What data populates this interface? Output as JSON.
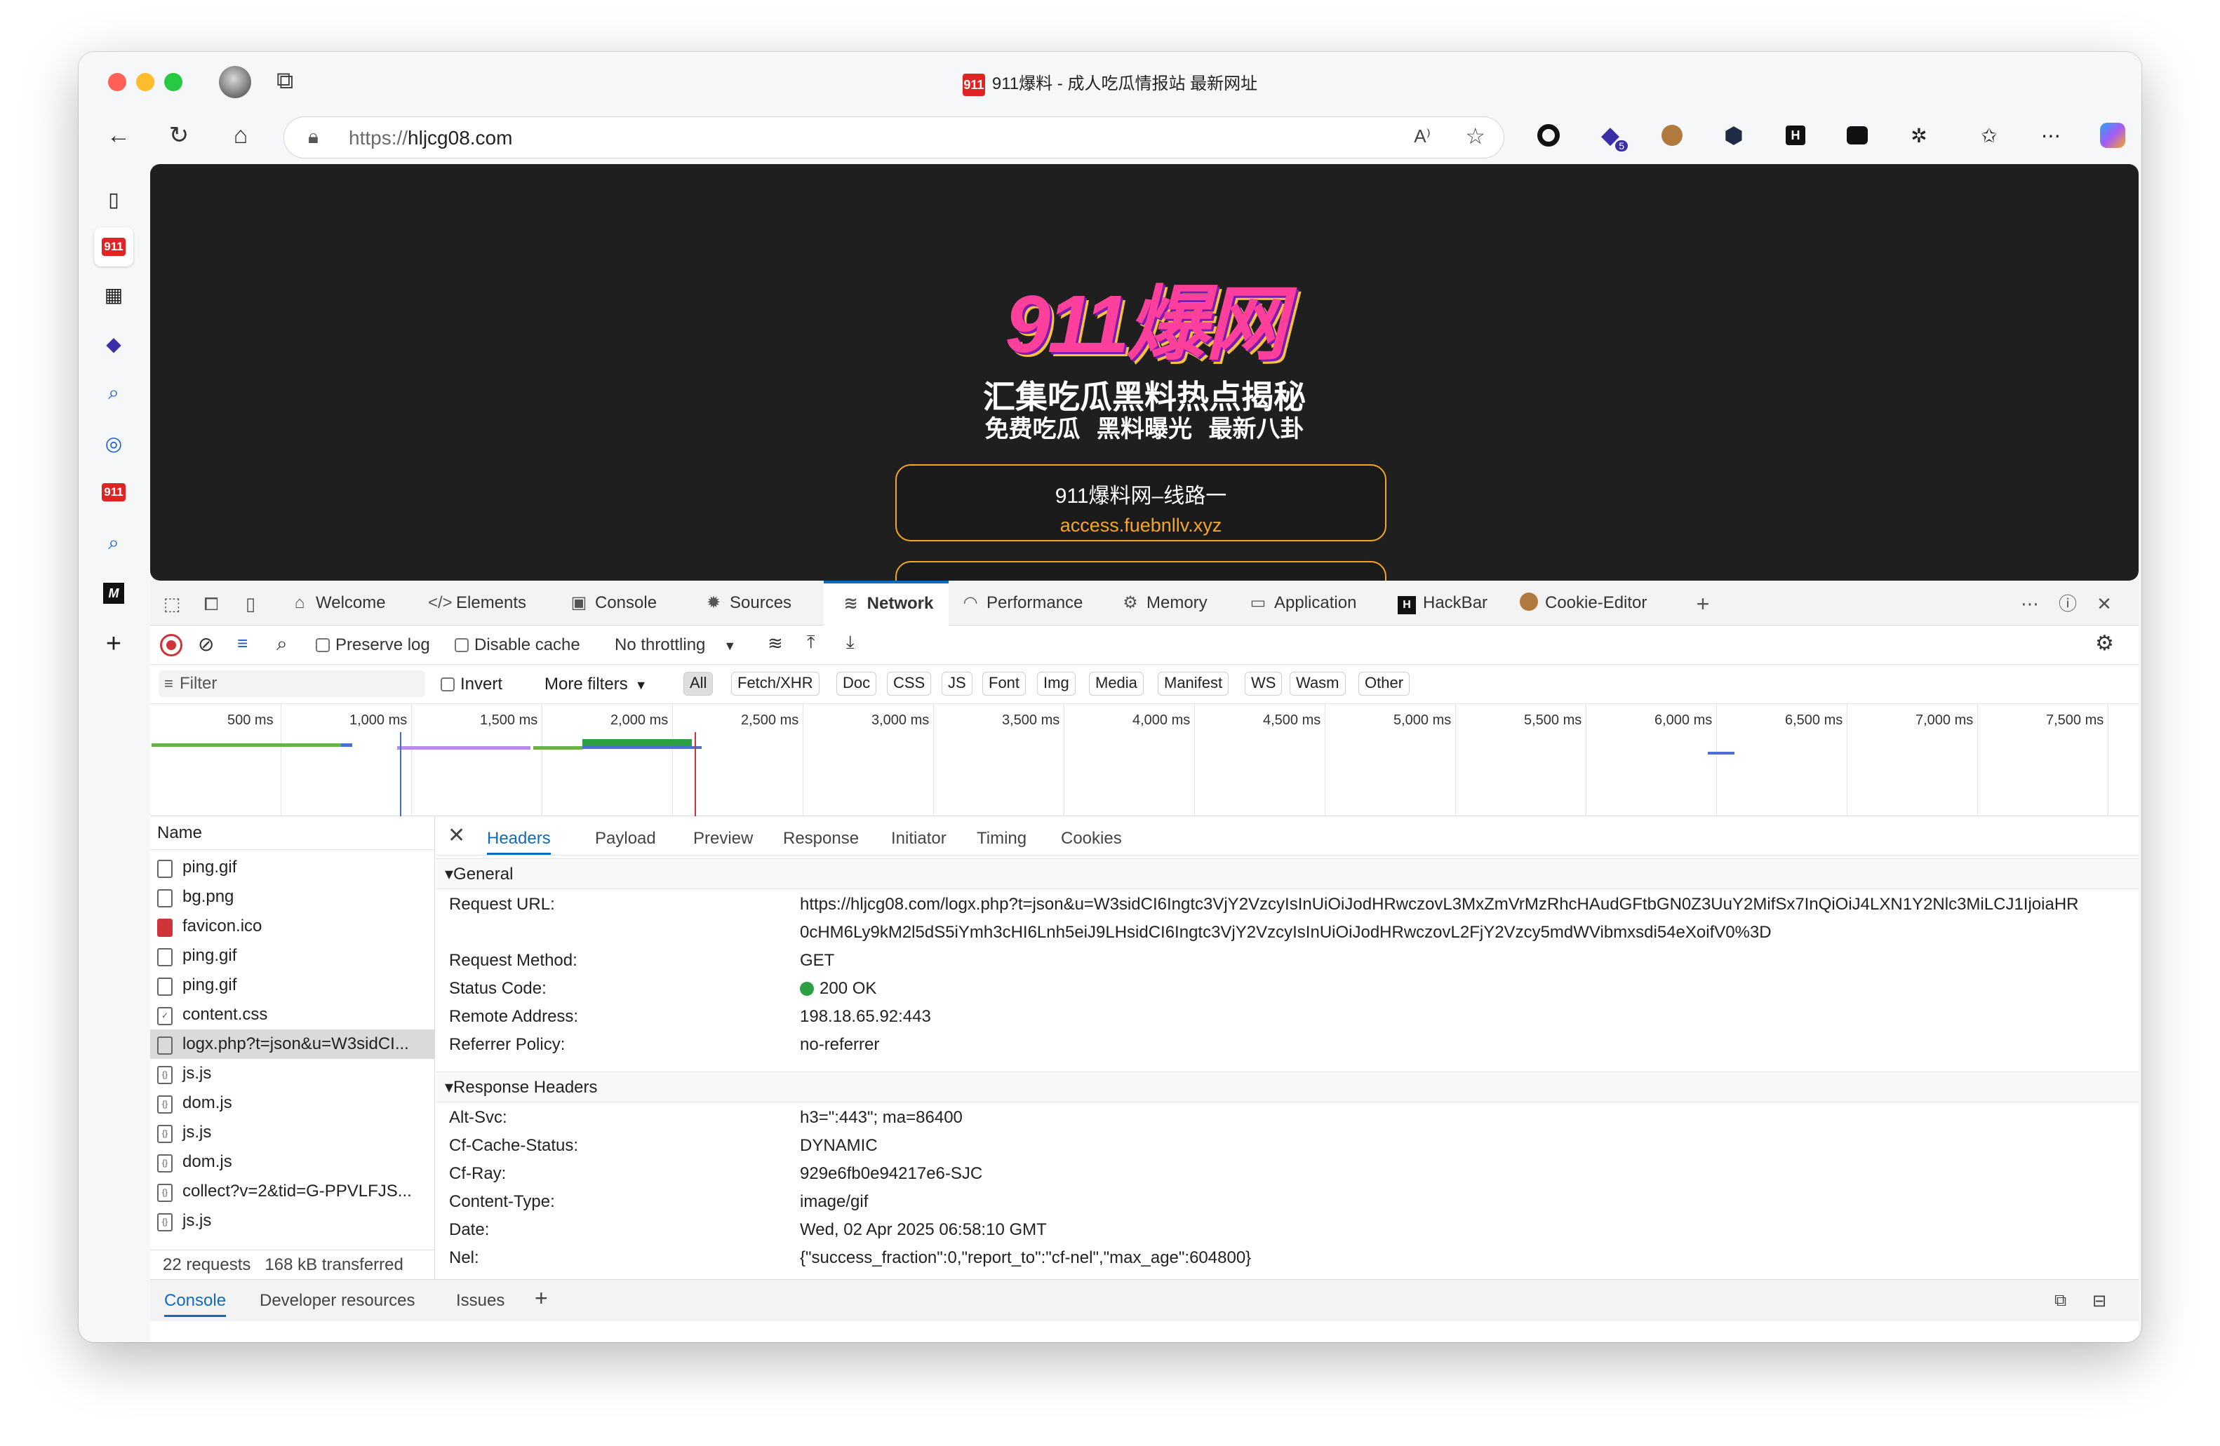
{
  "tab": {
    "title": "911爆料 - 成人吃瓜情报站 最新网址",
    "favicon_text": "911"
  },
  "address": {
    "scheme": "https://",
    "host": "hljcg08.com"
  },
  "extensions": [
    {
      "name": "circle-extension-icon"
    },
    {
      "name": "cube-extension-icon",
      "badge": "5"
    },
    {
      "name": "cookie-extension-icon"
    },
    {
      "name": "hexagon-extension-icon"
    },
    {
      "name": "hackbar-extension-icon",
      "label": "H"
    },
    {
      "name": "game-extension-icon"
    },
    {
      "name": "puzzle-extension-icon"
    }
  ],
  "page": {
    "logo": "911爆网",
    "tagline": "汇集吃瓜黑料热点揭秘",
    "subtagline": "免费吃瓜 黑料曝光 最新八卦",
    "line1_name": "911爆料网–线路一",
    "line1_url": "access.fuebnllv.xyz"
  },
  "devtools": {
    "tabs": [
      "Welcome",
      "Elements",
      "Console",
      "Sources",
      "Network",
      "Performance",
      "Memory",
      "Application",
      "HackBar",
      "Cookie-Editor"
    ],
    "active_tab": "Network",
    "toolbar": {
      "preserve_log": "Preserve log",
      "disable_cache": "Disable cache",
      "throttling": "No throttling"
    },
    "filter": {
      "placeholder": "Filter",
      "invert": "Invert",
      "more_filters": "More filters",
      "chips": [
        "All",
        "Fetch/XHR",
        "Doc",
        "CSS",
        "JS",
        "Font",
        "Img",
        "Media",
        "Manifest",
        "WS",
        "Wasm",
        "Other"
      ]
    },
    "timeline_ticks": [
      "500 ms",
      "1,000 ms",
      "1,500 ms",
      "2,000 ms",
      "2,500 ms",
      "3,000 ms",
      "3,500 ms",
      "4,000 ms",
      "4,500 ms",
      "5,000 ms",
      "5,500 ms",
      "6,000 ms",
      "6,500 ms",
      "7,000 ms",
      "7,500 ms"
    ],
    "name_header": "Name",
    "requests": [
      "ping.gif",
      "bg.png",
      "favicon.ico",
      "ping.gif",
      "ping.gif",
      "content.css",
      "logx.php?t=json&u=W3sidCI...",
      "js.js",
      "dom.js",
      "js.js",
      "dom.js",
      "collect?v=2&tid=G-PPVLFJS...",
      "js.js"
    ],
    "summary": {
      "requests": "22 requests",
      "transferred": "168 kB transferred"
    },
    "detail_tabs": [
      "Headers",
      "Payload",
      "Preview",
      "Response",
      "Initiator",
      "Timing",
      "Cookies"
    ],
    "general_title": "▾General",
    "general": {
      "url_label": "Request URL:",
      "url_1": "https://hljcg08.com/logx.php?t=json&u=W3sidCI6Ingtc3VjY2VzcyIsInUiOiJodHRwczovL3MxZmVrMzRhcHAudGFtbGN0Z3UuY2MifSx7InQiOiJ4LXN1Y2Nlc3MiLCJ1IjoiaHR",
      "url_2": "0cHM6Ly9kM2l5dS5iYmh3cHI6Lnh5eiJ9LHsidCI6Ingtc3VjY2VzcyIsInUiOiJodHRwczovL2FjY2Vzcy5mdWVibmxsdi54eXoifV0%3D",
      "method_label": "Request Method:",
      "method": "GET",
      "status_label": "Status Code:",
      "status": "200 OK",
      "remote_label": "Remote Address:",
      "remote": "198.18.65.92:443",
      "referrer_label": "Referrer Policy:",
      "referrer": "no-referrer"
    },
    "response_title": "▾Response Headers",
    "response": [
      {
        "k": "Alt-Svc:",
        "v": "h3=\":443\"; ma=86400"
      },
      {
        "k": "Cf-Cache-Status:",
        "v": "DYNAMIC"
      },
      {
        "k": "Cf-Ray:",
        "v": "929e6fb0e94217e6-SJC"
      },
      {
        "k": "Content-Type:",
        "v": "image/gif"
      },
      {
        "k": "Date:",
        "v": "Wed, 02 Apr 2025 06:58:10 GMT"
      },
      {
        "k": "Nel:",
        "v": "{\"success_fraction\":0,\"report_to\":\"cf-nel\",\"max_age\":604800}"
      }
    ],
    "drawer_tabs": [
      "Console",
      "Developer resources",
      "Issues"
    ]
  }
}
